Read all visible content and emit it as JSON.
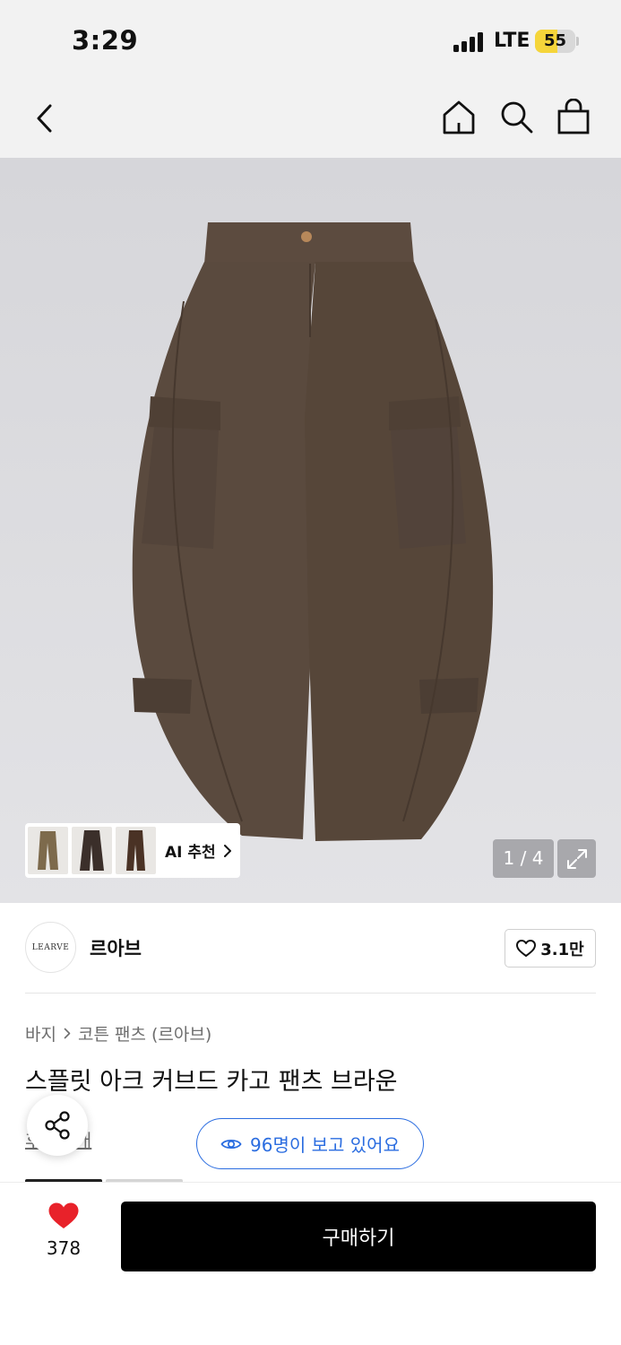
{
  "status_bar": {
    "time": "3:29",
    "network": "LTE",
    "battery": "55",
    "battery_level": 0.55
  },
  "nav": {
    "back_icon": "chevron-left-icon",
    "home_icon": "home-icon",
    "search_icon": "search-icon",
    "cart_icon": "shopping-bag-icon"
  },
  "gallery": {
    "pager": "1 / 4",
    "ai_label": "AI 추천",
    "expand_icon": "expand-icon",
    "thumb_count": 3
  },
  "brand": {
    "logo_text": "LEARVE",
    "name": "르아브",
    "likes": "3.1만"
  },
  "product": {
    "breadcrumb": [
      "바지",
      "코튼 팬츠 (르아브)"
    ],
    "title": "스플릿 아크 커브드 카고 팬츠 브라운",
    "reviews": "후기 3개",
    "viewers": "96명이 보고 있어요"
  },
  "bottom_bar": {
    "wish_count": "378",
    "buy_label": "구매하기"
  },
  "colors": {
    "accent_blue": "#2b6de0",
    "heart_red": "#e8222a",
    "battery_yellow": "#f5d53a",
    "buy_button": "#000000",
    "pants_brown": "#5a4a3e"
  }
}
